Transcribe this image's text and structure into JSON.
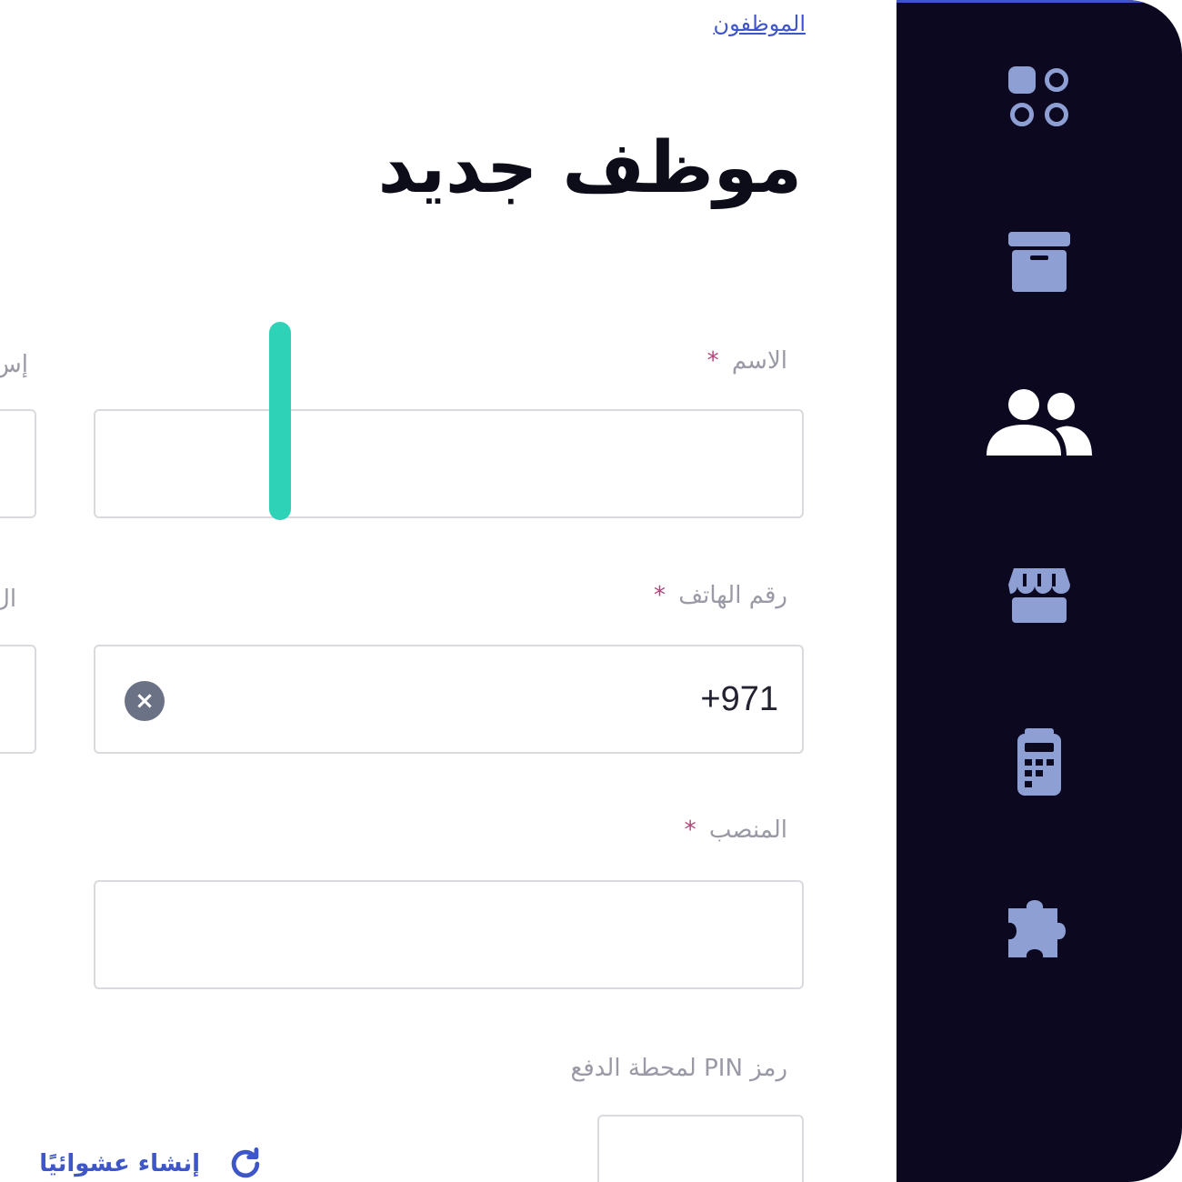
{
  "breadcrumb": {
    "label": "الموظفون"
  },
  "page": {
    "title": "موظف جديد"
  },
  "form": {
    "required_mark": "*",
    "name": {
      "label": "الاسم",
      "value": ""
    },
    "phone": {
      "label": "رقم الهاتف",
      "value": "+971",
      "clear_glyph": "×"
    },
    "position": {
      "label": "المنصب",
      "value": ""
    },
    "pin": {
      "label": "رمز PIN لمحطة الدفع",
      "value": "",
      "generate_label": "إنشاء عشوائيًا"
    },
    "partial_left": {
      "label_1": "إس",
      "label_2": "ال"
    }
  },
  "sidebar": {
    "items": [
      {
        "icon": "dashboard-grid-icon",
        "active": false
      },
      {
        "icon": "archive-box-icon",
        "active": false
      },
      {
        "icon": "users-icon",
        "active": true
      },
      {
        "icon": "store-icon",
        "active": false
      },
      {
        "icon": "pos-terminal-icon",
        "active": false
      },
      {
        "icon": "puzzle-piece-icon",
        "active": false
      }
    ]
  },
  "colors": {
    "sidebar_bg": "#0b0820",
    "sidebar_icon": "#8e9fd4",
    "active_icon": "#ffffff",
    "active_indicator": "#2ed3b7",
    "link": "#3f56c9",
    "required": "#b3437a",
    "label": "#9a9aa6",
    "input_border": "#d9d9de"
  }
}
